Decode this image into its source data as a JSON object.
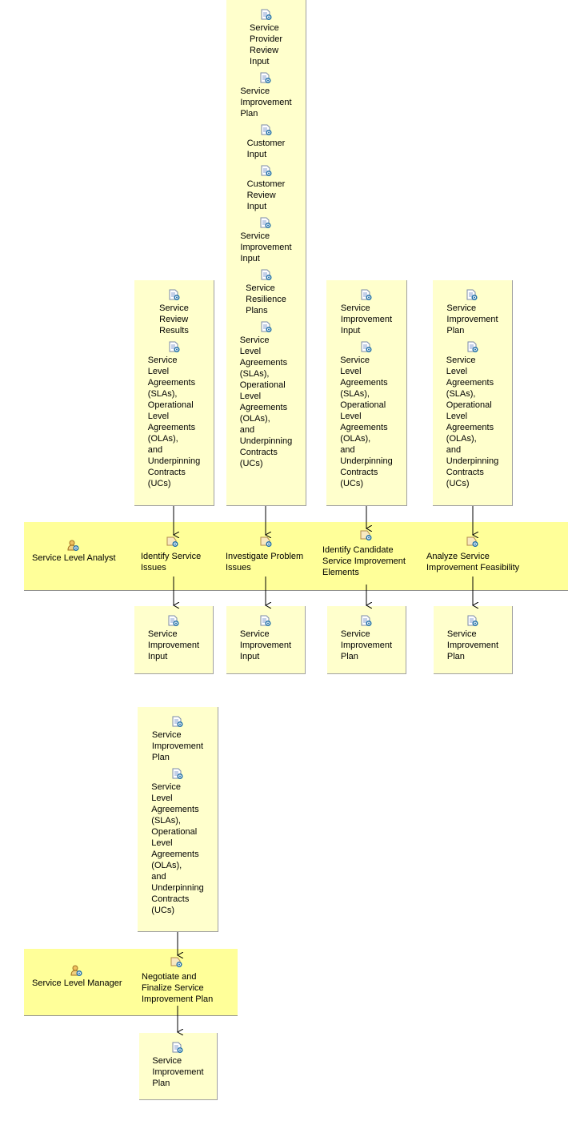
{
  "icon_names": {
    "artifact": "work-product-icon",
    "task": "task-icon",
    "role": "role-icon"
  },
  "colors": {
    "box": "#ffffcc",
    "lane": "#ffff99",
    "icon_blue": "#1f6fa8"
  },
  "inputs": [
    {
      "items": [
        "Service\nReview\nResults",
        "Service\nLevel\nAgreements\n(SLAs),\nOperational\nLevel\nAgreements\n(OLAs),\nand\nUnderpinning\nContracts\n(UCs)"
      ]
    },
    {
      "items": [
        "Service\nProvider\nReview\nInput",
        "Service\nImprovement\nPlan",
        "Customer\nInput",
        "Customer\nReview\nInput",
        "Service\nImprovement\nInput",
        "Service\nResilience\nPlans",
        "Service\nLevel\nAgreements\n(SLAs),\nOperational\nLevel\nAgreements\n(OLAs),\nand\nUnderpinning\nContracts\n(UCs)"
      ]
    },
    {
      "items": [
        "Service\nImprovement\nInput",
        "Service\nLevel\nAgreements\n(SLAs),\nOperational\nLevel\nAgreements\n(OLAs),\nand\nUnderpinning\nContracts\n(UCs)"
      ]
    },
    {
      "items": [
        "Service\nImprovement\nPlan",
        "Service\nLevel\nAgreements\n(SLAs),\nOperational\nLevel\nAgreements\n(OLAs),\nand\nUnderpinning\nContracts\n(UCs)"
      ]
    },
    {
      "items": [
        "Service\nImprovement\nPlan",
        "Service\nLevel\nAgreements\n(SLAs),\nOperational\nLevel\nAgreements\n(OLAs),\nand\nUnderpinning\nContracts\n(UCs)"
      ]
    }
  ],
  "lanes": [
    {
      "role": "Service Level Analyst",
      "tasks": [
        "Identify Service\nIssues",
        "Investigate Problem\nIssues",
        "Identify Candidate\nService Improvement\nElements",
        "Analyze Service\nImprovement Feasibility"
      ]
    },
    {
      "role": "Service Level Manager",
      "tasks": [
        "Negotiate and\nFinalize Service\nImprovement Plan"
      ]
    }
  ],
  "outputs": [
    {
      "items": [
        "Service\nImprovement\nInput"
      ]
    },
    {
      "items": [
        "Service\nImprovement\nInput"
      ]
    },
    {
      "items": [
        "Service\nImprovement\nPlan"
      ]
    },
    {
      "items": [
        "Service\nImprovement\nPlan"
      ]
    },
    {
      "items": [
        "Service\nImprovement\nPlan"
      ]
    }
  ]
}
